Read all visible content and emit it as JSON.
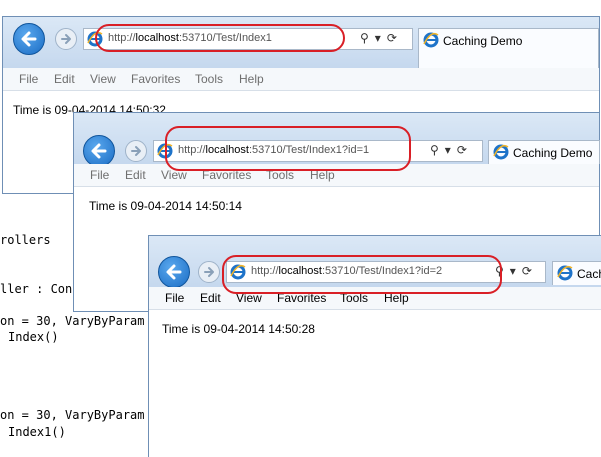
{
  "background_code": {
    "lines": [
      {
        "text": "rollers"
      },
      {
        "text": "ller : Cont"
      },
      {
        "text": "on = 30, VaryByParam"
      },
      {
        "text": "Index()"
      },
      {
        "text": "on = 30, VaryByParam"
      },
      {
        "text": "Index1()"
      }
    ]
  },
  "windows": [
    {
      "url_prefix": "http://",
      "url_host": "localhost",
      "url_rest": ":53710/Test/Index1",
      "tab_title": "Caching Demo",
      "menu": [
        "File",
        "Edit",
        "View",
        "Favorites",
        "Tools",
        "Help"
      ],
      "content": "Time is 09-04-2014 14:50:32"
    },
    {
      "url_prefix": "http://",
      "url_host": "localhost",
      "url_rest": ":53710/Test/Index1?id=1",
      "tab_title": "Caching Demo",
      "menu": [
        "File",
        "Edit",
        "View",
        "Favorites",
        "Tools",
        "Help"
      ],
      "content": "Time is 09-04-2014 14:50:14"
    },
    {
      "url_prefix": "http://",
      "url_host": "localhost",
      "url_rest": ":53710/Test/Index1?id=2",
      "tab_title": "Cach",
      "menu": [
        "File",
        "Edit",
        "View",
        "Favorites",
        "Tools",
        "Help"
      ],
      "content": "Time is 09-04-2014 14:50:28"
    }
  ],
  "colors": {
    "highlight": "#d91f26",
    "chrome": "#c5d8ee",
    "back_button": "#1a6cc4"
  },
  "icons": [
    "back-arrow-icon",
    "forward-arrow-icon",
    "ie-logo-icon",
    "search-icon",
    "dropdown-icon",
    "refresh-icon"
  ]
}
